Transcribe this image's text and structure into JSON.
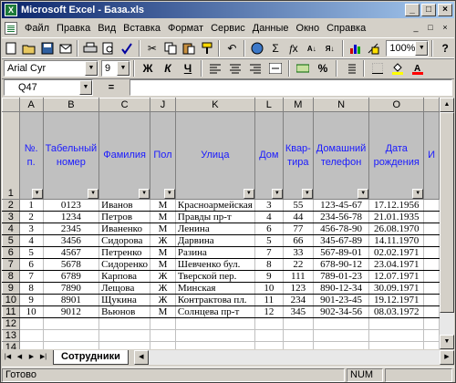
{
  "window": {
    "app_icon": "excel-icon",
    "title": "Microsoft Excel - База.xls",
    "controls": [
      "_",
      "□",
      "×"
    ]
  },
  "menubar": {
    "items": [
      "Файл",
      "Правка",
      "Вид",
      "Вставка",
      "Формат",
      "Сервис",
      "Данные",
      "Окно",
      "Справка"
    ],
    "doc_controls": [
      "_",
      "□",
      "×"
    ]
  },
  "toolbar_standard": {
    "zoom": "100%",
    "icons": [
      "new-icon",
      "open-icon",
      "save-icon",
      "email-icon",
      "print-icon",
      "preview-icon",
      "spelling-icon",
      "cut-icon",
      "copy-icon",
      "paste-icon",
      "format-painter-icon",
      "undo-icon",
      "hyperlink-icon",
      "autosum-icon",
      "function-icon",
      "sort-asc-icon",
      "sort-desc-icon",
      "chart-wizard-icon",
      "drawing-icon",
      "help-icon"
    ]
  },
  "toolbar_format": {
    "font": "Arial Cyr",
    "size": "9",
    "bold": "Ж",
    "italic": "К",
    "underline": "Ч"
  },
  "formula_bar": {
    "name_box": "Q47",
    "equals": "=",
    "value": ""
  },
  "columns": [
    "A",
    "B",
    "C",
    "J",
    "K",
    "L",
    "M",
    "N",
    "O",
    ""
  ],
  "headers": [
    "№. п.",
    "Табельный номер",
    "Фамилия",
    "Пол",
    "Улица",
    "Дом",
    "Квар-тира",
    "Домашний телефон",
    "Дата рождения",
    "И"
  ],
  "rows": [
    [
      "1",
      "0123",
      "Иванов",
      "М",
      "Красноармейская",
      "3",
      "55",
      "123-45-67",
      "17.12.1956",
      ""
    ],
    [
      "2",
      "1234",
      "Петров",
      "М",
      "Правды пр-т",
      "4",
      "44",
      "234-56-78",
      "21.01.1935",
      ""
    ],
    [
      "3",
      "2345",
      "Иваненко",
      "М",
      "Ленина",
      "6",
      "77",
      "456-78-90",
      "26.08.1970",
      ""
    ],
    [
      "4",
      "3456",
      "Сидорова",
      "Ж",
      "Дарвина",
      "5",
      "66",
      "345-67-89",
      "14.11.1970",
      ""
    ],
    [
      "5",
      "4567",
      "Петренко",
      "М",
      "Разина",
      "7",
      "33",
      "567-89-01",
      "02.02.1971",
      ""
    ],
    [
      "6",
      "5678",
      "Сидоренко",
      "М",
      "Шевченко бул.",
      "8",
      "22",
      "678-90-12",
      "23.04.1971",
      ""
    ],
    [
      "7",
      "6789",
      "Карпова",
      "Ж",
      "Тверской пер.",
      "9",
      "111",
      "789-01-23",
      "12.07.1971",
      ""
    ],
    [
      "8",
      "7890",
      "Лещова",
      "Ж",
      "Минская",
      "10",
      "123",
      "890-12-34",
      "30.09.1971",
      ""
    ],
    [
      "9",
      "8901",
      "Щукина",
      "Ж",
      "Контрактова пл.",
      "11",
      "234",
      "901-23-45",
      "19.12.1971",
      ""
    ],
    [
      "10",
      "9012",
      "Вьюнов",
      "М",
      "Солнцева пр-т",
      "12",
      "345",
      "902-34-56",
      "08.03.1972",
      ""
    ]
  ],
  "row_numbers": [
    "1",
    "2",
    "3",
    "4",
    "5",
    "6",
    "7",
    "8",
    "9",
    "10",
    "11",
    "12",
    "13",
    "14"
  ],
  "sheet_tab": "Сотрудники",
  "status": {
    "ready": "Готово",
    "num": "NUM"
  }
}
